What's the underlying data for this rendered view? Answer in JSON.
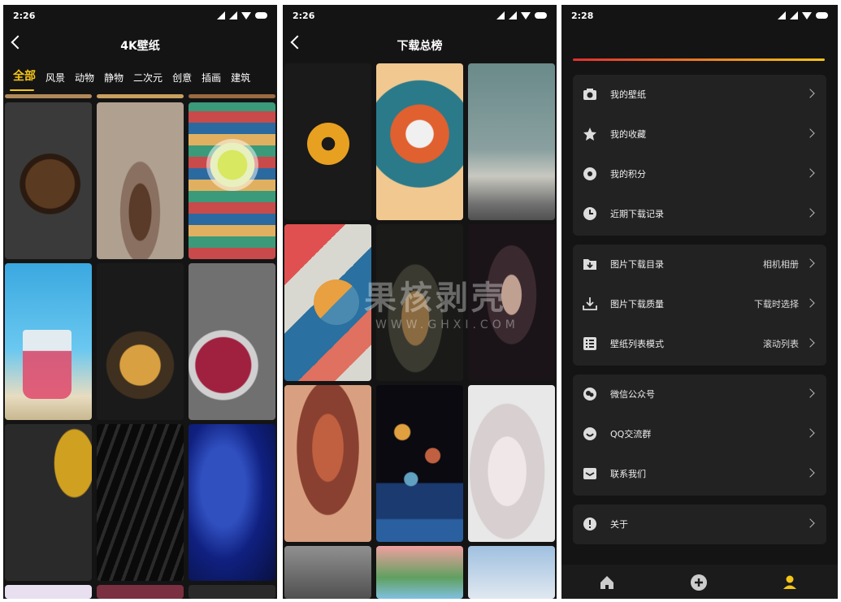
{
  "screen1": {
    "time": "2:26",
    "title": "4K壁纸",
    "categories": [
      "全部",
      "风景",
      "动物",
      "静物",
      "二次元",
      "创意",
      "插画",
      "建筑"
    ]
  },
  "screen2": {
    "time": "2:26",
    "title": "下载总榜"
  },
  "watermark": {
    "main": "果核剥壳",
    "sub": "WWW.GHXI.COM"
  },
  "screen3": {
    "time": "2:28",
    "group1": [
      {
        "label": "我的壁纸",
        "icon": "camera-icon"
      },
      {
        "label": "我的收藏",
        "icon": "star-icon"
      },
      {
        "label": "我的积分",
        "icon": "coin-icon"
      },
      {
        "label": "近期下载记录",
        "icon": "clock-icon"
      }
    ],
    "group2": [
      {
        "label": "图片下载目录",
        "value": "相机相册",
        "icon": "folder-download-icon"
      },
      {
        "label": "图片下载质量",
        "value": "下载时选择",
        "icon": "download-icon"
      },
      {
        "label": "壁纸列表模式",
        "value": "滚动列表",
        "icon": "list-icon"
      }
    ],
    "group3": [
      {
        "label": "微信公众号",
        "icon": "wechat-icon"
      },
      {
        "label": "QQ交流群",
        "icon": "qq-icon"
      },
      {
        "label": "联系我们",
        "icon": "mail-icon"
      }
    ],
    "group4": [
      {
        "label": "关于",
        "icon": "info-icon"
      }
    ]
  },
  "colors": {
    "accent": "#f5c518",
    "background": "#141414",
    "card": "#222222"
  }
}
